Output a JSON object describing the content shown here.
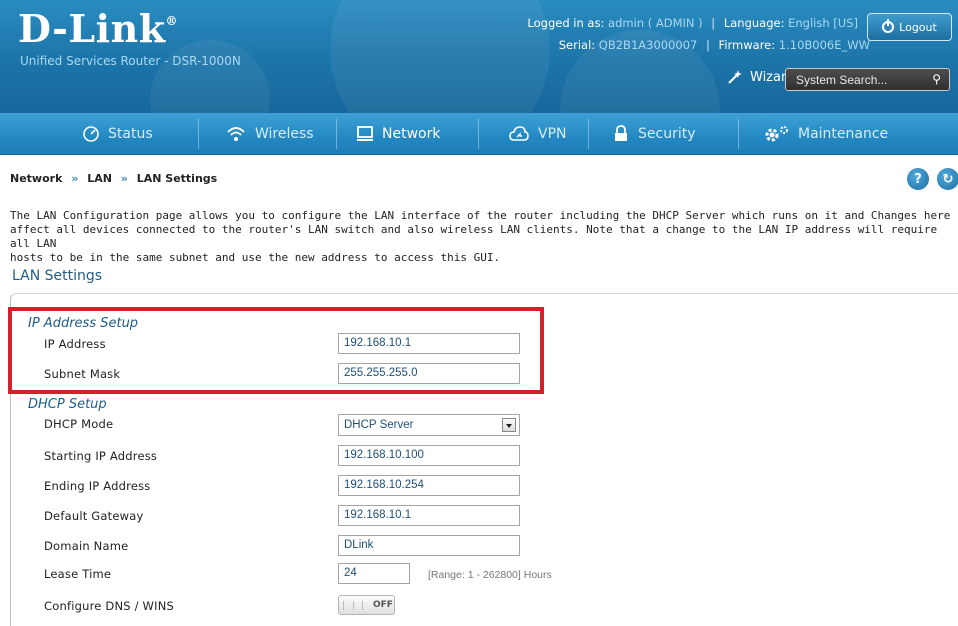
{
  "header": {
    "brand": "D-Link",
    "subtitle": "Unified Services Router - DSR-1000N",
    "logged_in_label": "Logged in as:",
    "logged_in_value": "admin ( ADMIN )",
    "language_label": "Language:",
    "language_value": "English [US]",
    "serial_label": "Serial:",
    "serial_value": "QB2B1A3000007",
    "firmware_label": "Firmware:",
    "firmware_value": "1.10B006E_WW",
    "logout_label": "Logout",
    "wizard_label": "Wizard",
    "search_placeholder": "System Search..."
  },
  "nav": {
    "items": [
      {
        "label": "Status",
        "icon": "status-icon"
      },
      {
        "label": "Wireless",
        "icon": "wireless-icon"
      },
      {
        "label": "Network",
        "icon": "network-icon",
        "active": true
      },
      {
        "label": "VPN",
        "icon": "vpn-icon"
      },
      {
        "label": "Security",
        "icon": "security-icon"
      },
      {
        "label": "Maintenance",
        "icon": "maintenance-icon"
      }
    ]
  },
  "breadcrumb": [
    "Network",
    "LAN",
    "LAN Settings"
  ],
  "breadcrumb_sep": "»",
  "description": "The LAN Configuration page allows you to configure the LAN interface of the router including the DHCP Server which runs on it and Changes here\naffect all devices connected to the router's LAN switch and also wireless LAN clients. Note that a change to the LAN IP address will require all LAN\nhosts to be in the same subnet and use the new address to access this GUI.",
  "section_title": "LAN Settings",
  "ip_setup": {
    "title": "IP Address Setup",
    "ip_label": "IP Address",
    "ip_value": "192.168.10.1",
    "mask_label": "Subnet Mask",
    "mask_value": "255.255.255.0"
  },
  "dhcp_setup": {
    "title": "DHCP Setup",
    "mode_label": "DHCP Mode",
    "mode_value": "DHCP Server",
    "start_label": "Starting IP Address",
    "start_value": "192.168.10.100",
    "end_label": "Ending IP Address",
    "end_value": "192.168.10.254",
    "gateway_label": "Default Gateway",
    "gateway_value": "192.168.10.1",
    "domain_label": "Domain Name",
    "domain_value": "DLink",
    "lease_label": "Lease Time",
    "lease_value": "24",
    "lease_range": "[Range: 1 - 262800] Hours",
    "dns_label": "Configure DNS / WINS",
    "dns_toggle": "OFF"
  },
  "colors": {
    "header_blue": "#1c74a8",
    "nav_blue": "#2488c2",
    "title_blue": "#1f5c8a",
    "highlight_red": "#d1212b"
  }
}
